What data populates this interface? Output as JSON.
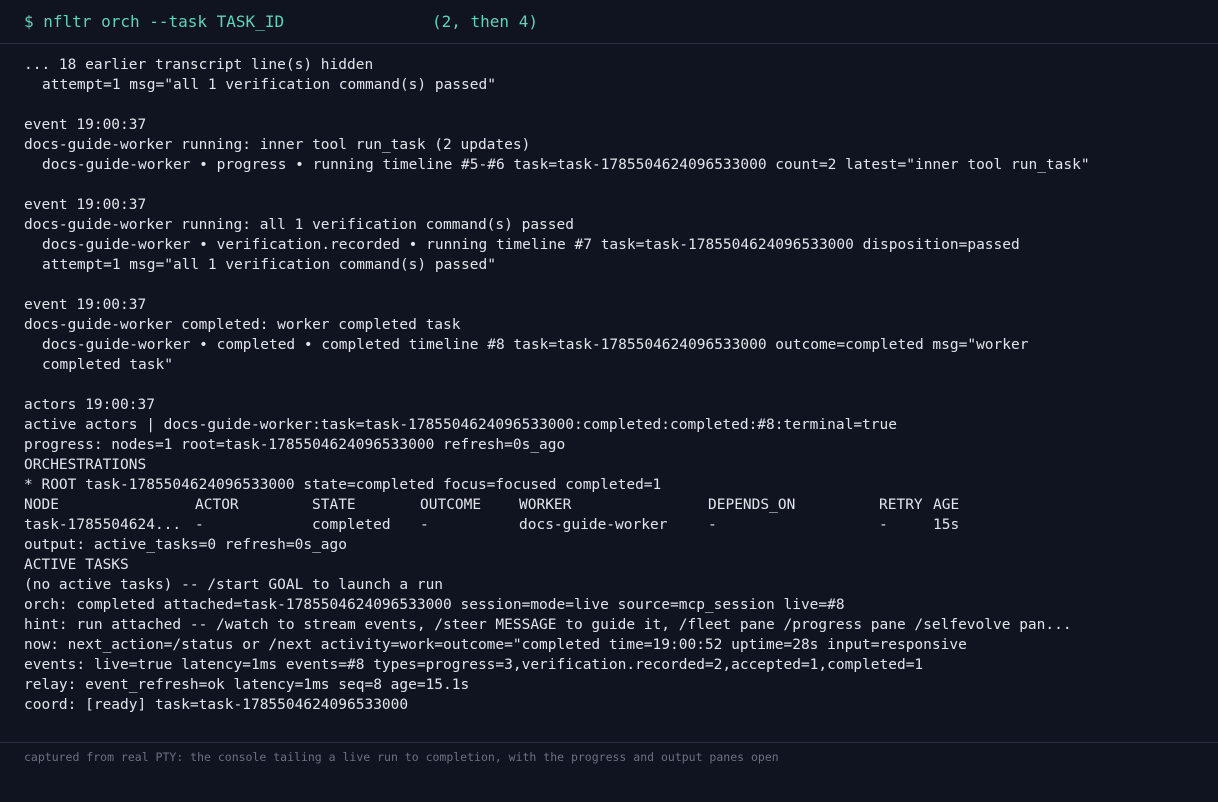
{
  "header": {
    "command": "$ nfltr orch --task TASK_ID",
    "note": "(2, then 4)"
  },
  "lines": [
    {
      "text": "... 18 earlier transcript line(s) hidden",
      "indent": false
    },
    {
      "text": "attempt=1 msg=\"all 1 verification command(s) passed\"",
      "indent": true
    },
    {
      "text": "",
      "indent": false
    },
    {
      "text": "event 19:00:37",
      "indent": false
    },
    {
      "text": "docs-guide-worker running: inner tool run_task (2 updates)",
      "indent": false
    },
    {
      "text": "docs-guide-worker • progress • running timeline #5-#6 task=task-1785504624096533000 count=2 latest=\"inner tool run_task\"",
      "indent": true
    },
    {
      "text": "",
      "indent": false
    },
    {
      "text": "event 19:00:37",
      "indent": false
    },
    {
      "text": "docs-guide-worker running: all 1 verification command(s) passed",
      "indent": false
    },
    {
      "text": "docs-guide-worker • verification.recorded • running timeline #7 task=task-1785504624096533000 disposition=passed",
      "indent": true
    },
    {
      "text": "attempt=1 msg=\"all 1 verification command(s) passed\"",
      "indent": true
    },
    {
      "text": "",
      "indent": false
    },
    {
      "text": "event 19:00:37",
      "indent": false
    },
    {
      "text": "docs-guide-worker completed: worker completed task",
      "indent": false
    },
    {
      "text": "docs-guide-worker • completed • completed timeline #8 task=task-1785504624096533000 outcome=completed msg=\"worker",
      "indent": true
    },
    {
      "text": "completed task\"",
      "indent": true
    },
    {
      "text": "",
      "indent": false
    },
    {
      "text": "actors 19:00:37",
      "indent": false
    },
    {
      "text": "active actors | docs-guide-worker:task=task-1785504624096533000:completed:completed:#8:terminal=true",
      "indent": false
    },
    {
      "text": "progress: nodes=1 root=task-1785504624096533000 refresh=0s_ago",
      "indent": false
    },
    {
      "text": "ORCHESTRATIONS",
      "indent": false
    },
    {
      "text": "* ROOT task-1785504624096533000 state=completed focus=focused completed=1",
      "indent": false
    }
  ],
  "table": {
    "headers": [
      "NODE",
      "ACTOR",
      "STATE",
      "OUTCOME",
      "WORKER",
      "DEPENDS_ON",
      "RETRY",
      "AGE"
    ],
    "rows": [
      [
        "task-1785504624...",
        "-",
        "completed",
        "-",
        "docs-guide-worker",
        "-",
        "-",
        "15s"
      ]
    ]
  },
  "lines_after": [
    "output: active_tasks=0 refresh=0s_ago",
    "ACTIVE TASKS",
    "(no active tasks) -- /start GOAL to launch a run",
    "orch: completed attached=task-1785504624096533000 session=mode=live source=mcp_session live=#8",
    "hint: run attached -- /watch to stream events, /steer MESSAGE to guide it, /fleet pane /progress pane /selfevolve pan...",
    "now: next_action=/status or /next activity=work=outcome=\"completed time=19:00:52 uptime=28s input=responsive",
    "events: live=true latency=1ms events=#8 types=progress=3,verification.recorded=2,accepted=1,completed=1",
    "relay: event_refresh=ok latency=1ms seq=8 age=15.1s",
    "coord: [ready] task=task-1785504624096533000"
  ],
  "prompt": ">",
  "caption": "captured from real PTY: the console tailing a live run to completion, with the progress and output panes open"
}
